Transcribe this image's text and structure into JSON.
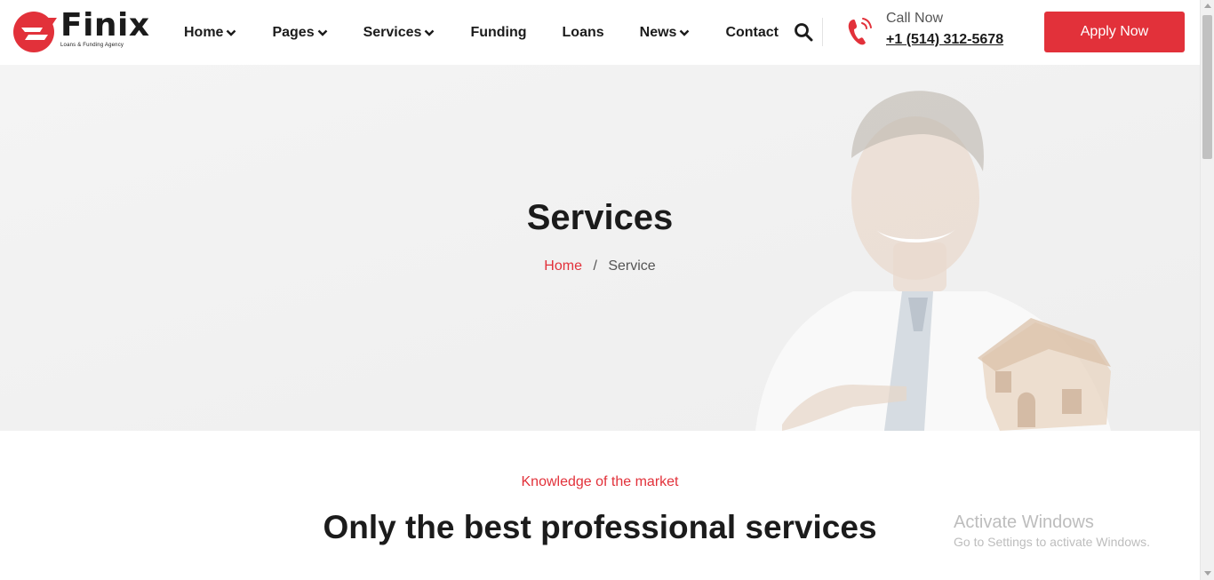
{
  "brand": {
    "name": "Finix",
    "tagline": "Loans & Funding Agency",
    "accent_color": "#e2313a"
  },
  "nav": {
    "items": [
      {
        "label": "Home",
        "has_dropdown": true
      },
      {
        "label": "Pages",
        "has_dropdown": true
      },
      {
        "label": "Services",
        "has_dropdown": true
      },
      {
        "label": "Funding",
        "has_dropdown": false
      },
      {
        "label": "Loans",
        "has_dropdown": false
      },
      {
        "label": "News",
        "has_dropdown": true
      },
      {
        "label": "Contact",
        "has_dropdown": false
      }
    ],
    "search_icon": "search-icon",
    "chevron_icon": "chevron-down-icon"
  },
  "contact": {
    "icon": "phone-icon",
    "label": "Call Now",
    "phone": "+1 (514) 312-5678"
  },
  "cta": {
    "label": "Apply Now"
  },
  "hero": {
    "title": "Services",
    "breadcrumb": {
      "home": "Home",
      "separator": "/",
      "current": "Service"
    }
  },
  "section": {
    "eyebrow": "Knowledge of the market",
    "title": "Only the best professional services"
  },
  "watermark": {
    "title": "Activate Windows",
    "subtitle": "Go to Settings to activate Windows."
  }
}
